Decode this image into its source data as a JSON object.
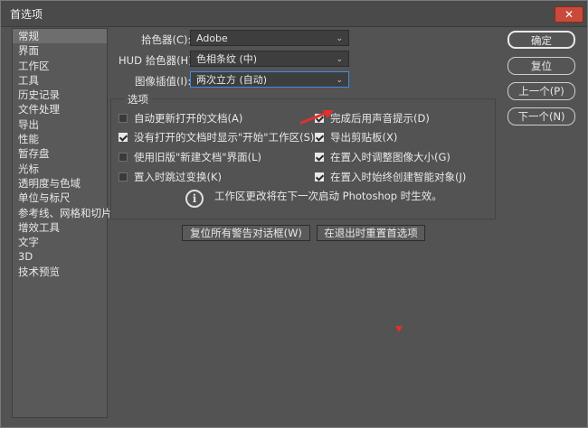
{
  "window": {
    "title": "首选项",
    "close_glyph": "✕"
  },
  "sidebar": {
    "items": [
      {
        "label": "常规",
        "selected": true
      },
      {
        "label": "界面"
      },
      {
        "label": "工作区"
      },
      {
        "label": "工具"
      },
      {
        "label": "历史记录"
      },
      {
        "label": "文件处理"
      },
      {
        "label": "导出"
      },
      {
        "label": "性能"
      },
      {
        "label": "暂存盘"
      },
      {
        "label": "光标"
      },
      {
        "label": "透明度与色域"
      },
      {
        "label": "单位与标尺"
      },
      {
        "label": "参考线、网格和切片"
      },
      {
        "label": "增效工具"
      },
      {
        "label": "文字"
      },
      {
        "label": "3D"
      },
      {
        "label": "技术预览"
      }
    ]
  },
  "fields": {
    "color_picker": {
      "label": "拾色器(C):",
      "value": "Adobe"
    },
    "hud_color_picker": {
      "label": "HUD 拾色器(H):",
      "value": "色相条纹 (中)"
    },
    "image_interpolation": {
      "label": "图像插值(I):",
      "value": "两次立方 (自动)"
    }
  },
  "options": {
    "legend": "选项",
    "checkboxes": [
      {
        "label": "自动更新打开的文档(A)",
        "checked": false
      },
      {
        "label": "没有打开的文档时显示\"开始\"工作区(S)",
        "checked": true
      },
      {
        "label": "使用旧版\"新建文档\"界面(L)",
        "checked": false
      },
      {
        "label": "置入时跳过变换(K)",
        "checked": false
      },
      {
        "label": "完成后用声音提示(D)",
        "checked": true
      },
      {
        "label": "导出剪贴板(X)",
        "checked": true
      },
      {
        "label": "在置入时调整图像大小(G)",
        "checked": true
      },
      {
        "label": "在置入时始终创建智能对象(J)",
        "checked": true
      }
    ],
    "info_icon": "i",
    "info_text": "工作区更改将在下一次启动 Photoshop 时生效。"
  },
  "buttons": {
    "reset_warnings": "复位所有警告对话框(W)",
    "reset_on_quit": "在退出时重置首选项",
    "ok": "确定",
    "reset": "复位",
    "prev": "上一个(P)",
    "next": "下一个(N)"
  },
  "colors": {
    "annotation_red": "#e03030",
    "focus_blue": "#3a8ee6"
  }
}
